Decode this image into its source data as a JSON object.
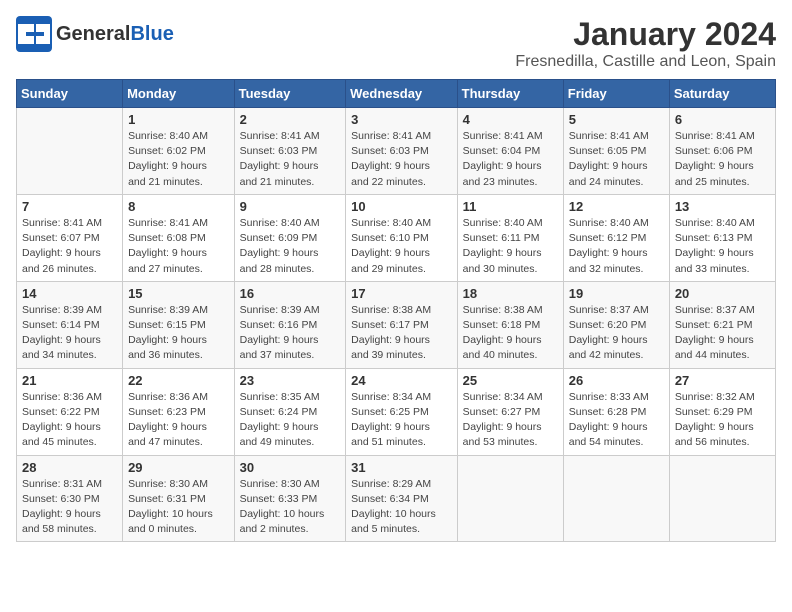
{
  "header": {
    "logo_line1": "General",
    "logo_line2": "Blue",
    "month": "January 2024",
    "location": "Fresnedilla, Castille and Leon, Spain"
  },
  "days_of_week": [
    "Sunday",
    "Monday",
    "Tuesday",
    "Wednesday",
    "Thursday",
    "Friday",
    "Saturday"
  ],
  "weeks": [
    [
      {
        "day": "",
        "info": ""
      },
      {
        "day": "1",
        "info": "Sunrise: 8:40 AM\nSunset: 6:02 PM\nDaylight: 9 hours\nand 21 minutes."
      },
      {
        "day": "2",
        "info": "Sunrise: 8:41 AM\nSunset: 6:03 PM\nDaylight: 9 hours\nand 21 minutes."
      },
      {
        "day": "3",
        "info": "Sunrise: 8:41 AM\nSunset: 6:03 PM\nDaylight: 9 hours\nand 22 minutes."
      },
      {
        "day": "4",
        "info": "Sunrise: 8:41 AM\nSunset: 6:04 PM\nDaylight: 9 hours\nand 23 minutes."
      },
      {
        "day": "5",
        "info": "Sunrise: 8:41 AM\nSunset: 6:05 PM\nDaylight: 9 hours\nand 24 minutes."
      },
      {
        "day": "6",
        "info": "Sunrise: 8:41 AM\nSunset: 6:06 PM\nDaylight: 9 hours\nand 25 minutes."
      }
    ],
    [
      {
        "day": "7",
        "info": "Sunrise: 8:41 AM\nSunset: 6:07 PM\nDaylight: 9 hours\nand 26 minutes."
      },
      {
        "day": "8",
        "info": "Sunrise: 8:41 AM\nSunset: 6:08 PM\nDaylight: 9 hours\nand 27 minutes."
      },
      {
        "day": "9",
        "info": "Sunrise: 8:40 AM\nSunset: 6:09 PM\nDaylight: 9 hours\nand 28 minutes."
      },
      {
        "day": "10",
        "info": "Sunrise: 8:40 AM\nSunset: 6:10 PM\nDaylight: 9 hours\nand 29 minutes."
      },
      {
        "day": "11",
        "info": "Sunrise: 8:40 AM\nSunset: 6:11 PM\nDaylight: 9 hours\nand 30 minutes."
      },
      {
        "day": "12",
        "info": "Sunrise: 8:40 AM\nSunset: 6:12 PM\nDaylight: 9 hours\nand 32 minutes."
      },
      {
        "day": "13",
        "info": "Sunrise: 8:40 AM\nSunset: 6:13 PM\nDaylight: 9 hours\nand 33 minutes."
      }
    ],
    [
      {
        "day": "14",
        "info": "Sunrise: 8:39 AM\nSunset: 6:14 PM\nDaylight: 9 hours\nand 34 minutes."
      },
      {
        "day": "15",
        "info": "Sunrise: 8:39 AM\nSunset: 6:15 PM\nDaylight: 9 hours\nand 36 minutes."
      },
      {
        "day": "16",
        "info": "Sunrise: 8:39 AM\nSunset: 6:16 PM\nDaylight: 9 hours\nand 37 minutes."
      },
      {
        "day": "17",
        "info": "Sunrise: 8:38 AM\nSunset: 6:17 PM\nDaylight: 9 hours\nand 39 minutes."
      },
      {
        "day": "18",
        "info": "Sunrise: 8:38 AM\nSunset: 6:18 PM\nDaylight: 9 hours\nand 40 minutes."
      },
      {
        "day": "19",
        "info": "Sunrise: 8:37 AM\nSunset: 6:20 PM\nDaylight: 9 hours\nand 42 minutes."
      },
      {
        "day": "20",
        "info": "Sunrise: 8:37 AM\nSunset: 6:21 PM\nDaylight: 9 hours\nand 44 minutes."
      }
    ],
    [
      {
        "day": "21",
        "info": "Sunrise: 8:36 AM\nSunset: 6:22 PM\nDaylight: 9 hours\nand 45 minutes."
      },
      {
        "day": "22",
        "info": "Sunrise: 8:36 AM\nSunset: 6:23 PM\nDaylight: 9 hours\nand 47 minutes."
      },
      {
        "day": "23",
        "info": "Sunrise: 8:35 AM\nSunset: 6:24 PM\nDaylight: 9 hours\nand 49 minutes."
      },
      {
        "day": "24",
        "info": "Sunrise: 8:34 AM\nSunset: 6:25 PM\nDaylight: 9 hours\nand 51 minutes."
      },
      {
        "day": "25",
        "info": "Sunrise: 8:34 AM\nSunset: 6:27 PM\nDaylight: 9 hours\nand 53 minutes."
      },
      {
        "day": "26",
        "info": "Sunrise: 8:33 AM\nSunset: 6:28 PM\nDaylight: 9 hours\nand 54 minutes."
      },
      {
        "day": "27",
        "info": "Sunrise: 8:32 AM\nSunset: 6:29 PM\nDaylight: 9 hours\nand 56 minutes."
      }
    ],
    [
      {
        "day": "28",
        "info": "Sunrise: 8:31 AM\nSunset: 6:30 PM\nDaylight: 9 hours\nand 58 minutes."
      },
      {
        "day": "29",
        "info": "Sunrise: 8:30 AM\nSunset: 6:31 PM\nDaylight: 10 hours\nand 0 minutes."
      },
      {
        "day": "30",
        "info": "Sunrise: 8:30 AM\nSunset: 6:33 PM\nDaylight: 10 hours\nand 2 minutes."
      },
      {
        "day": "31",
        "info": "Sunrise: 8:29 AM\nSunset: 6:34 PM\nDaylight: 10 hours\nand 5 minutes."
      },
      {
        "day": "",
        "info": ""
      },
      {
        "day": "",
        "info": ""
      },
      {
        "day": "",
        "info": ""
      }
    ]
  ]
}
